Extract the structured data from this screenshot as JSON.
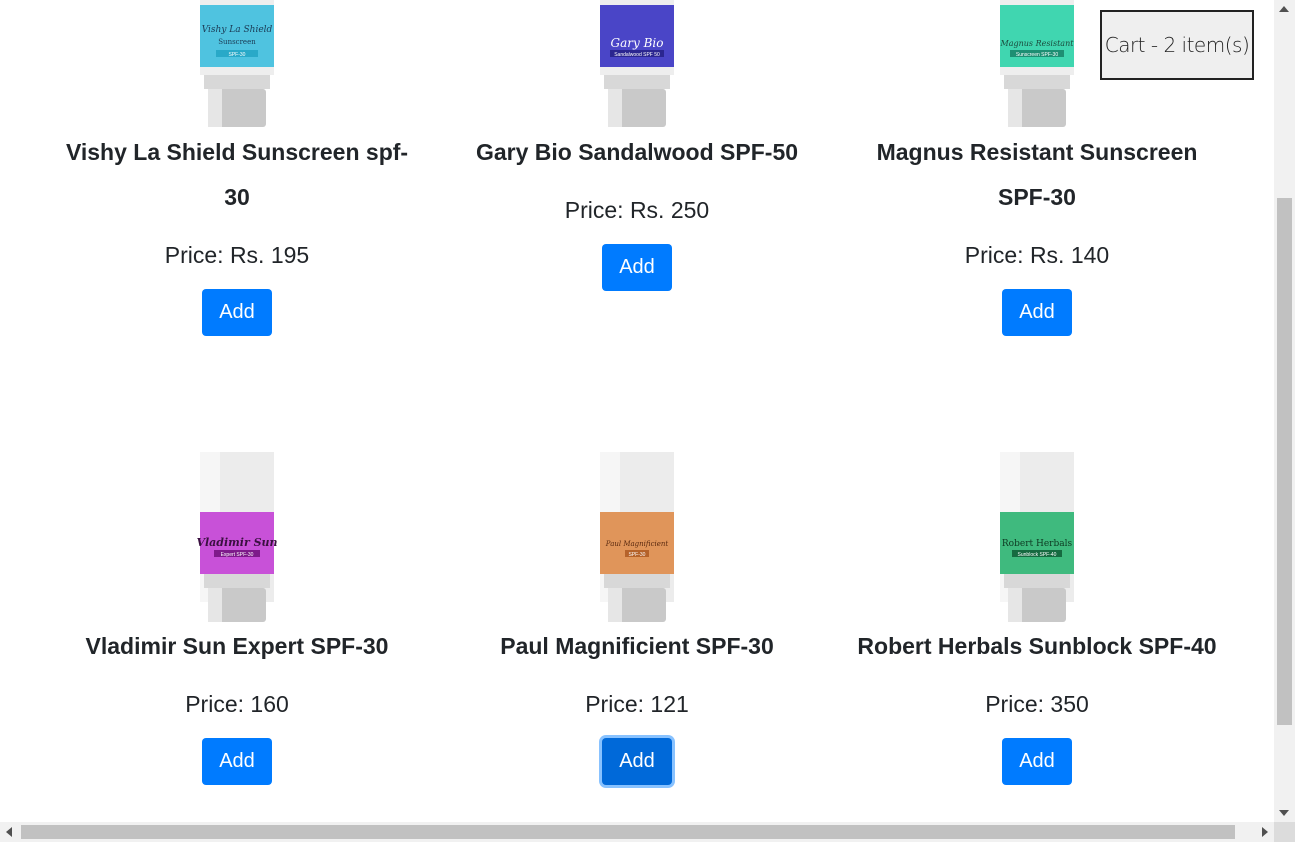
{
  "cart": {
    "label": "Cart - 2 item(s)"
  },
  "products": [
    {
      "name": "Vishy La Shield Sunscreen spf-30",
      "price": "Price: Rs. 195",
      "add_label": "Add",
      "tube_label": "Vishy La Shield",
      "tube_sub": "Sunscreen",
      "tube_badge": "SPF-30",
      "band_color": "#4fc3e0"
    },
    {
      "name": "Gary Bio Sandalwood SPF-50",
      "price": "Price: Rs. 250",
      "add_label": "Add",
      "tube_label": "Gary Bio",
      "tube_sub": "",
      "tube_badge": "Sandalwood SPF 50",
      "band_color": "#4a45c7"
    },
    {
      "name": "Magnus Resistant Sunscreen SPF-30",
      "price": "Price: Rs. 140",
      "add_label": "Add",
      "tube_label": "Magnus Resistant",
      "tube_sub": "",
      "tube_badge": "Sunscreen SPF-30",
      "band_color": "#40d6b0"
    },
    {
      "name": "Vladimir Sun Expert SPF-30",
      "price": "Price: 160",
      "add_label": "Add",
      "tube_label": "Vladimir Sun",
      "tube_sub": "",
      "tube_badge": "Expert SPF-30",
      "band_color": "#c851d8"
    },
    {
      "name": "Paul Magnificient SPF-30",
      "price": "Price: 121",
      "add_label": "Add",
      "tube_label": "Paul Magnificient",
      "tube_sub": "",
      "tube_badge": "SPF-30",
      "band_color": "#e0955a"
    },
    {
      "name": "Robert Herbals Sunblock SPF-40",
      "price": "Price: 350",
      "add_label": "Add",
      "tube_label": "Robert Herbals",
      "tube_sub": "",
      "tube_badge": "Sunblock SPF-40",
      "band_color": "#3fba7e"
    }
  ]
}
